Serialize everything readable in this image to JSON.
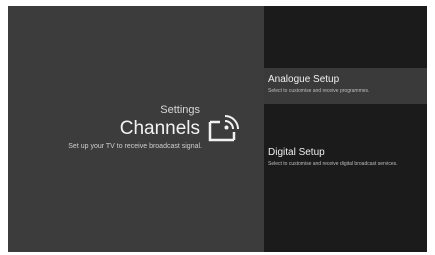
{
  "header": {
    "breadcrumb": "Settings",
    "title": "Channels",
    "description": "Set up your TV to receive broadcast signal.",
    "icon": "cast-broadcast-icon"
  },
  "menu": {
    "items": [
      {
        "label": "Analogue Setup",
        "description": "Select to customise and receive programmes.",
        "selected": true
      },
      {
        "label": "Digital Setup",
        "description": "Select to customise and receive digital broadcast services.",
        "selected": false
      }
    ]
  },
  "colors": {
    "left_panel_bg": "#3c3c3c",
    "right_panel_bg": "#1b1b1b",
    "selected_item_bg": "#3a3a3a",
    "text_primary": "#f2f2f2"
  }
}
